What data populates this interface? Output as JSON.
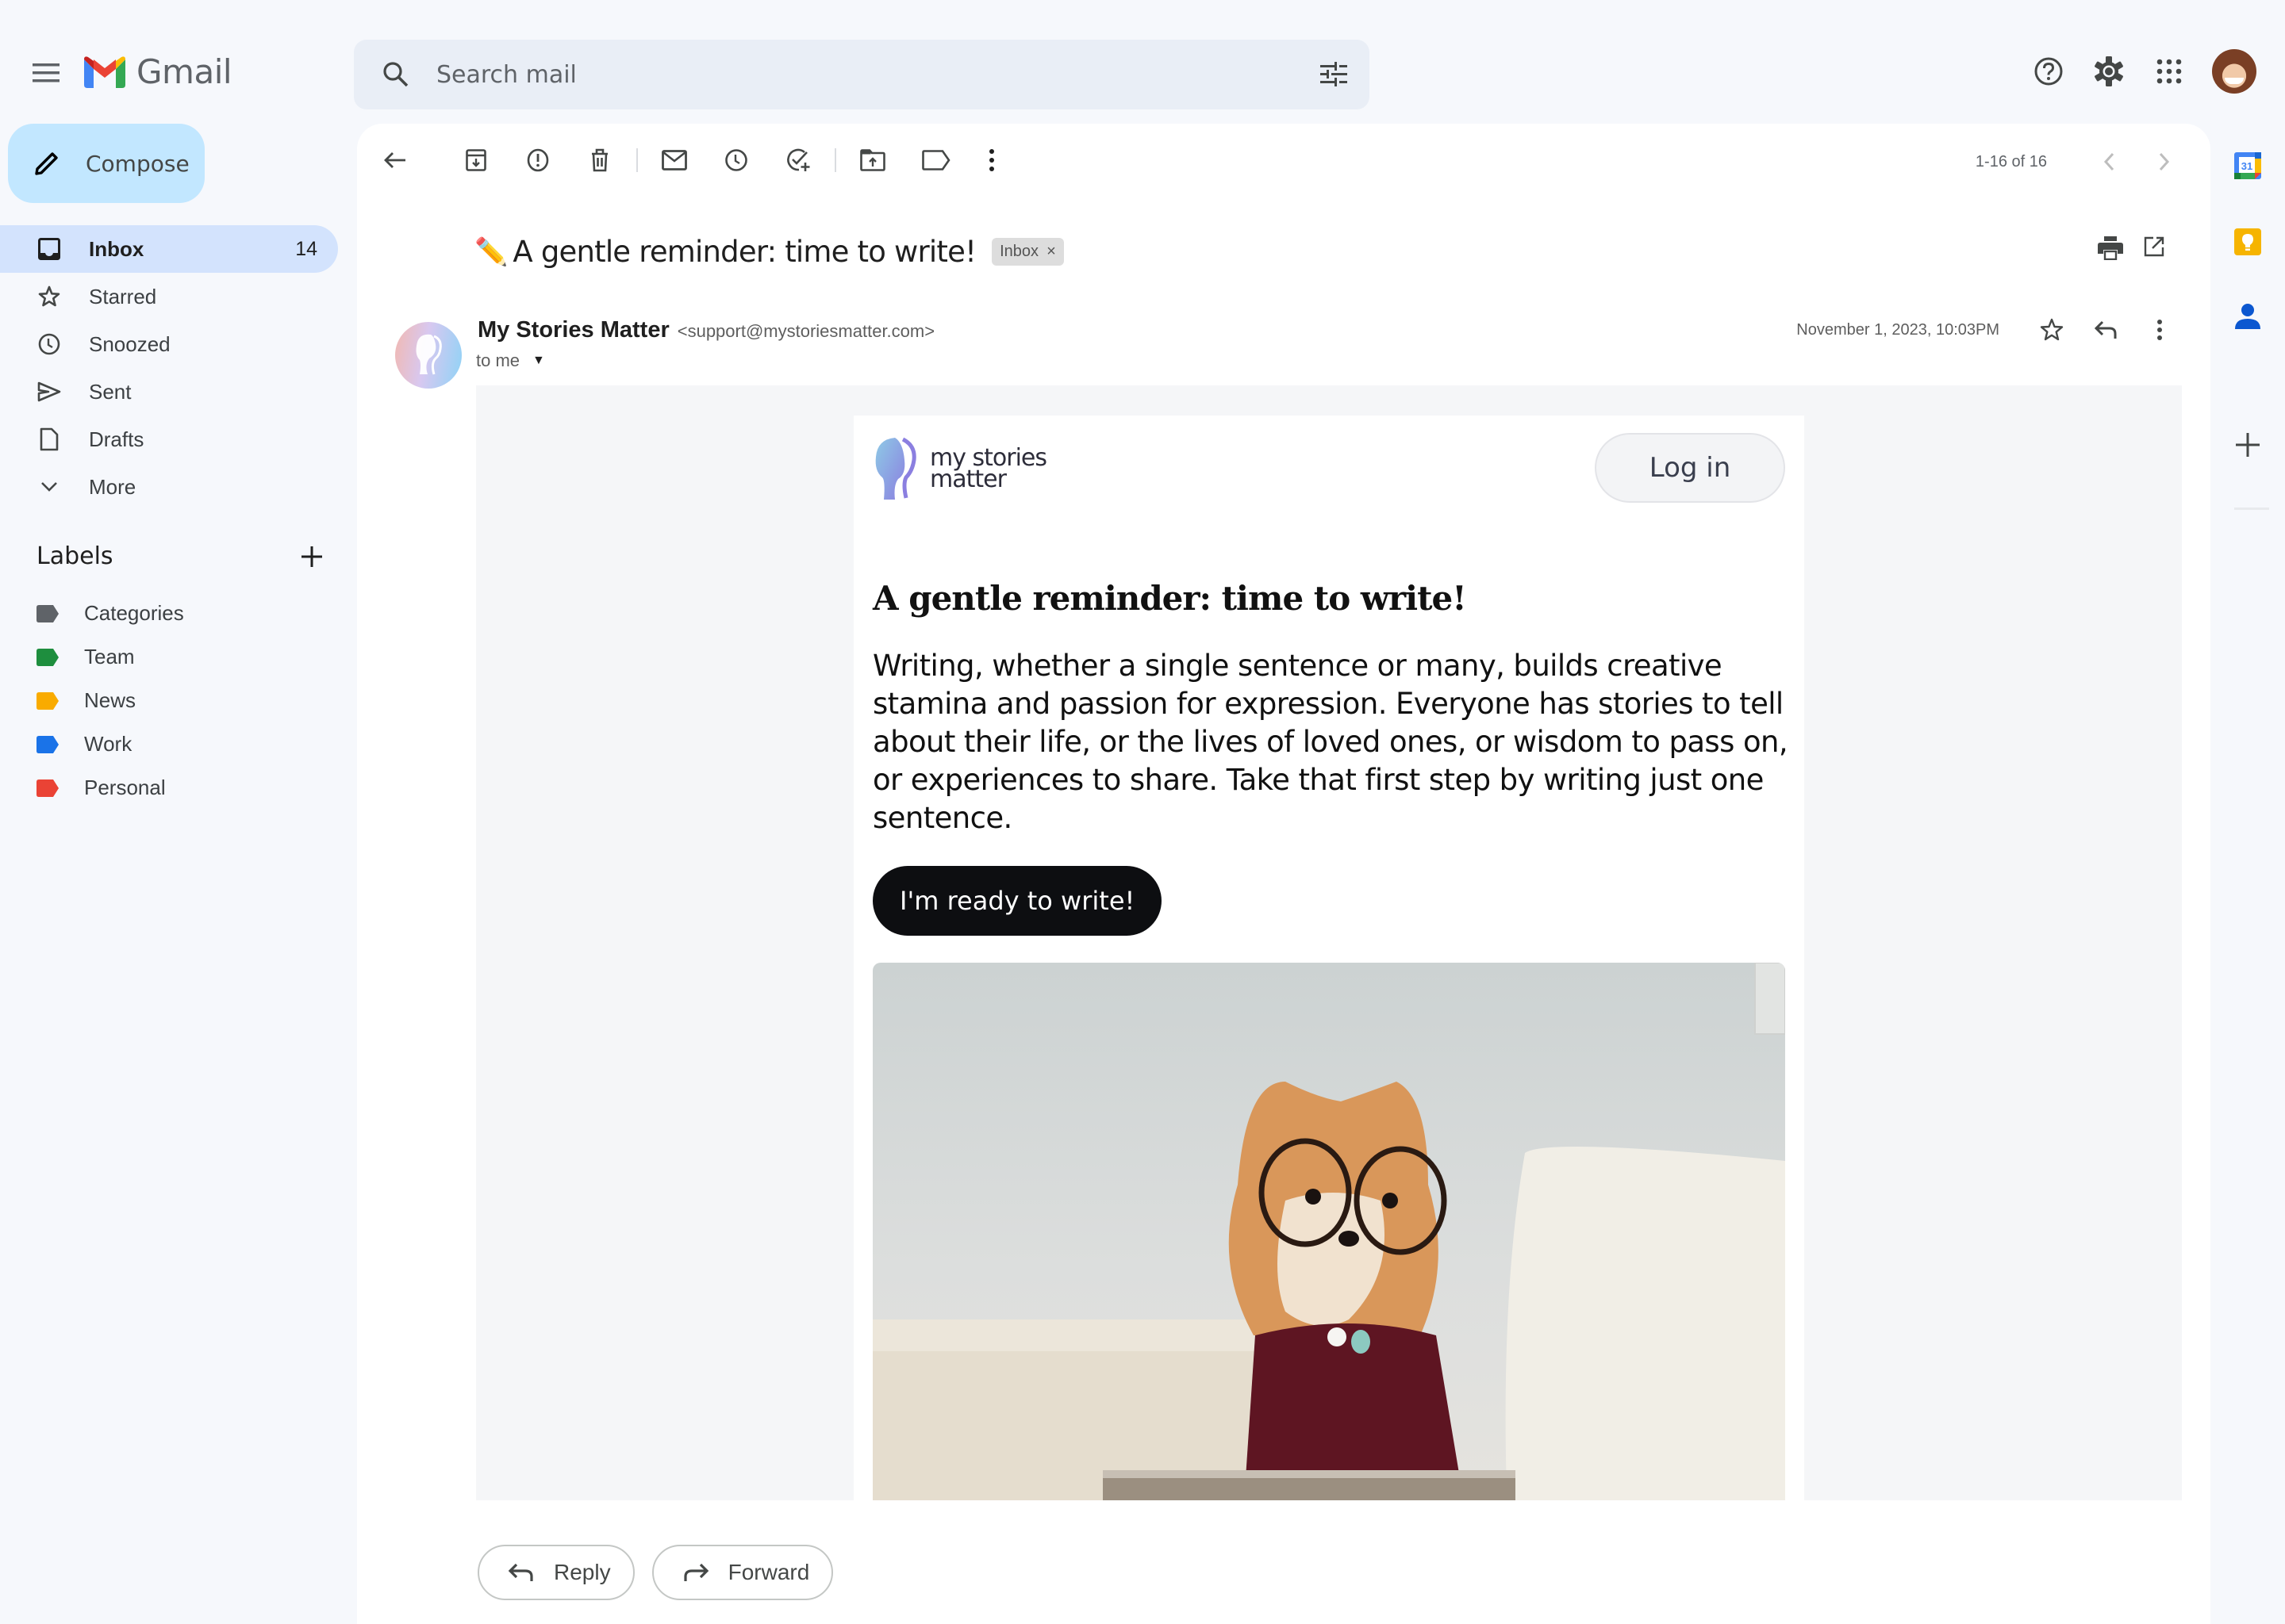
{
  "app": {
    "name": "Gmail",
    "menu_icon": "hamburger-menu-icon"
  },
  "search": {
    "placeholder": "Search mail",
    "value": ""
  },
  "header_icons": [
    "help-icon",
    "settings-icon",
    "apps-grid-icon",
    "account-avatar"
  ],
  "compose": {
    "label": "Compose"
  },
  "nav": [
    {
      "label": "Inbox",
      "count": "14",
      "icon": "inbox-icon",
      "active": true
    },
    {
      "label": "Starred",
      "count": "",
      "icon": "star-icon"
    },
    {
      "label": "Snoozed",
      "count": "",
      "icon": "clock-icon"
    },
    {
      "label": "Sent",
      "count": "",
      "icon": "send-icon"
    },
    {
      "label": "Drafts",
      "count": "",
      "icon": "draft-icon"
    },
    {
      "label": "More",
      "count": "",
      "icon": "chevron-down-icon"
    }
  ],
  "labels": {
    "title": "Labels",
    "items": [
      {
        "label": "Categories",
        "color": "#5f6368"
      },
      {
        "label": "Team",
        "color": "#1e8e3e"
      },
      {
        "label": "News",
        "color": "#f9ab00"
      },
      {
        "label": "Work",
        "color": "#1a73e8"
      },
      {
        "label": "Personal",
        "color": "#ea4335"
      }
    ]
  },
  "toolbar": {
    "actions": [
      "back",
      "archive",
      "report-spam",
      "delete",
      "mark-unread",
      "snooze",
      "add-to-tasks",
      "move-to",
      "label",
      "more"
    ],
    "pager_text": "1-16 of 16"
  },
  "message": {
    "subject_emoji": "✏️",
    "subject": "A gentle reminder: time to write!",
    "label_chip": "Inbox",
    "chip_close": "×",
    "sender_name": "My Stories Matter",
    "sender_email": "<support@mystoriesmatter.com>",
    "to": "to me",
    "date": "November 1, 2023, 10:03PM"
  },
  "email": {
    "brand_line1": "my stories",
    "brand_line2": "matter",
    "login_label": "Log in",
    "heading": "A gentle reminder: time to write!",
    "paragraph": "Writing, whether a single sentence or many, builds creative stamina and passion for expression. Everyone has stories to tell about their life, or the lives of loved ones, or wisdom to pass on, or experiences to share. Take that first step by writing just one sentence.",
    "cta_label": "I'm ready to write!",
    "image_alt": "Pomeranian dog wearing glasses and a red sweater"
  },
  "actions": {
    "reply_label": "Reply",
    "forward_label": "Forward"
  },
  "side_panel": [
    "calendar-app",
    "keep-app",
    "contacts-app",
    "add-addon"
  ],
  "colors": {
    "compose_bg": "#c2e7ff",
    "nav_active": "#d3e3fd",
    "search_bg": "#e9eef6",
    "cta_bg": "#0d0e11"
  }
}
